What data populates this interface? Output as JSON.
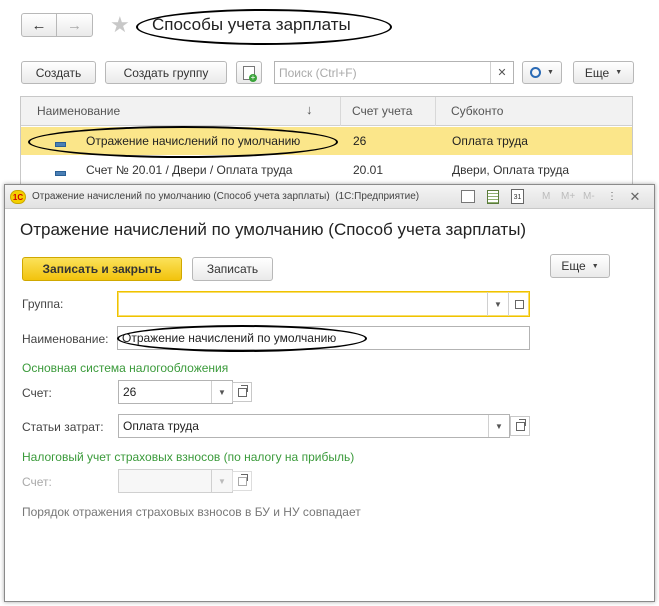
{
  "list_window": {
    "title": "Способы учета зарплаты",
    "toolbar": {
      "create": "Создать",
      "create_group": "Создать группу",
      "search_placeholder": "Поиск (Ctrl+F)",
      "more": "Еще"
    },
    "table": {
      "columns": [
        "Наименование",
        "Счет учета",
        "Субконто"
      ],
      "rows": [
        {
          "name": "Отражение начислений по умолчанию",
          "account": "26",
          "subconto": "Оплата труда"
        },
        {
          "name": "Счет № 20.01 / Двери / Оплата труда",
          "account": "20.01",
          "subconto": "Двери, Оплата труда"
        }
      ]
    }
  },
  "form_window": {
    "titlebar": "Отражение начислений по умолчанию (Способ учета зарплаты)  (1С:Предприятие)",
    "titlebar_logo": "1С",
    "titlebar_tools": [
      "M",
      "M+",
      "M-"
    ],
    "heading": "Отражение начислений по умолчанию (Способ учета зарплаты)",
    "buttons": {
      "save_close": "Записать и закрыть",
      "save": "Записать",
      "more": "Еще"
    },
    "fields": {
      "group_label": "Группа:",
      "group_value": "",
      "name_label": "Наименование:",
      "name_value": "Отражение начислений по умолчанию",
      "section1": "Основная система налогообложения",
      "account_label": "Счет:",
      "account_value": "26",
      "costs_label": "Статьи затрат:",
      "costs_value": "Оплата труда",
      "section2": "Налоговый учет страховых взносов (по налогу на прибыль)",
      "account2_label": "Счет:",
      "account2_value": "",
      "note": "Порядок отражения страховых взносов в БУ и НУ совпадает"
    }
  }
}
